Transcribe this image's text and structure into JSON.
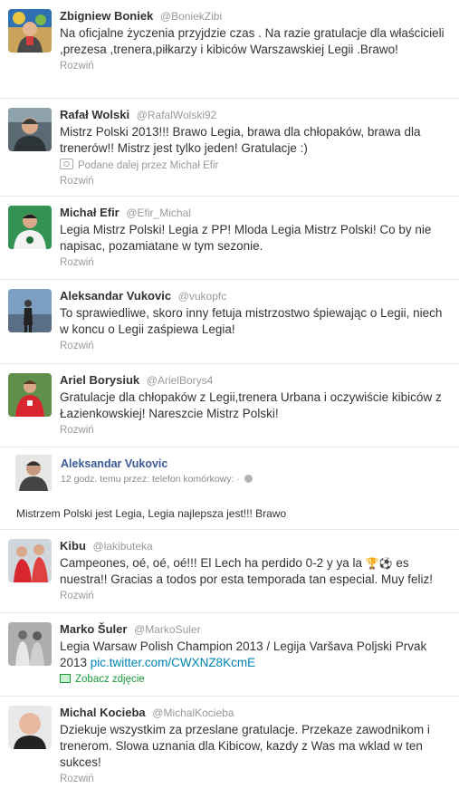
{
  "tweets": [
    {
      "name": "Zbigniew Boniek",
      "handle": "@BoniekZibi",
      "text": "Na oficjalne życzenia przyjdzie czas . Na razie gratulacje dla właścicieli ,prezesa ,trenera,piłkarzy  i kibiców Warszawskiej Legii .Brawo!",
      "expand": "Rozwiń"
    },
    {
      "name": "Rafał Wolski",
      "handle": "@RafalWolski92",
      "text": "Mistrz Polski 2013!!! Brawo Legia, brawa dla chłopaków, brawa dla trenerów!! Mistrz jest tylko jeden! Gratulacje :)",
      "retweeted_by": "Podane dalej przez Michał Efir",
      "expand": "Rozwiń"
    },
    {
      "name": "Michał Efir",
      "handle": "@Efir_Michal",
      "text": "Legia Mistrz Polski! Legia z PP! Mloda Legia Mistrz Polski! Co by nie napisac, pozamiatane w tym sezonie.",
      "expand": "Rozwiń"
    },
    {
      "name": "Aleksandar Vukovic",
      "handle": "@vukopfc",
      "text": "To sprawiedliwe, skoro inny fetuja mistrzostwo śpiewając o Legii, niech w koncu o Legii zaśpiewa Legia!",
      "expand": "Rozwiń"
    },
    {
      "name": "Ariel Borysiuk",
      "handle": "@ArielBorys4",
      "text": "Gratulacje dla chłopaków z Legii,trenera Urbana i oczywiście kibiców z Łazienkowskiej! Nareszcie Mistrz Polski!",
      "expand": "Rozwiń"
    }
  ],
  "facebook": {
    "name": "Aleksandar Vukovic",
    "meta": "12 godz. temu przez: telefon komórkowy: ·",
    "text": "Mistrzem Polski jest Legia, Legia najlepsza jest!!! Brawo"
  },
  "tweets2": [
    {
      "name": "Kibu",
      "handle": "@lakibuteka",
      "text_a": "Campeones, oé, oé, oé!!! El Lech ha perdido 0-2 y ya la ",
      "emoji": "🏆⚽",
      "text_b": " es nuestra!! Gracias a todos por esta temporada tan especial. Muy feliz!",
      "expand": "Rozwiń"
    },
    {
      "name": "Marko Šuler",
      "handle": "@MarkoSuler",
      "text": "Legia Warsaw Polish Champion 2013 / Legija Varšava Poljski Prvak 2013 ",
      "link": "pic.twitter.com/CWXNZ8KcmE",
      "photo": "Zobacz zdjęcie"
    },
    {
      "name": "Michal Kocieba",
      "handle": "@MichalKocieba",
      "text": "Dziekuje wszystkim za przeslane gratulacje. Przekaze zawodnikom i trenerom. Slowa uznania dla Kibicow, kazdy z Was ma wklad w ten sukces!",
      "expand": "Rozwiń"
    }
  ]
}
